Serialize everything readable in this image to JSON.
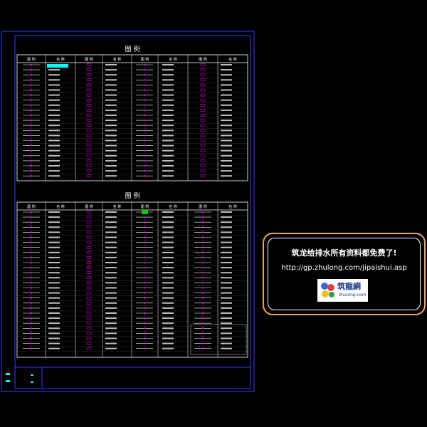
{
  "legend_top": {
    "title": "图  例",
    "headers": [
      "图 例",
      "名 称",
      "图 例",
      "名 称",
      "图 例",
      "名 称",
      "图 例",
      "名 称"
    ]
  },
  "legend_bottom": {
    "title": "图  例",
    "headers": [
      "图 例",
      "名 称",
      "图 例",
      "名 称",
      "图 例",
      "名 称",
      "图 例",
      "名 称"
    ]
  },
  "banner": {
    "title": "筑龙给排水所有资料都免费了!",
    "url": "http://gp.zhulong.com/jipaishui.asp",
    "logo_text": "筑龍網",
    "logo_sub": "zhulong.com"
  },
  "colors": {
    "frame": "#3a3aff",
    "line": "#ffffff",
    "symbol": "#ff00ff",
    "highlight": "#00ffff",
    "green": "#00cc00",
    "banner_border": "#f0a45a"
  }
}
